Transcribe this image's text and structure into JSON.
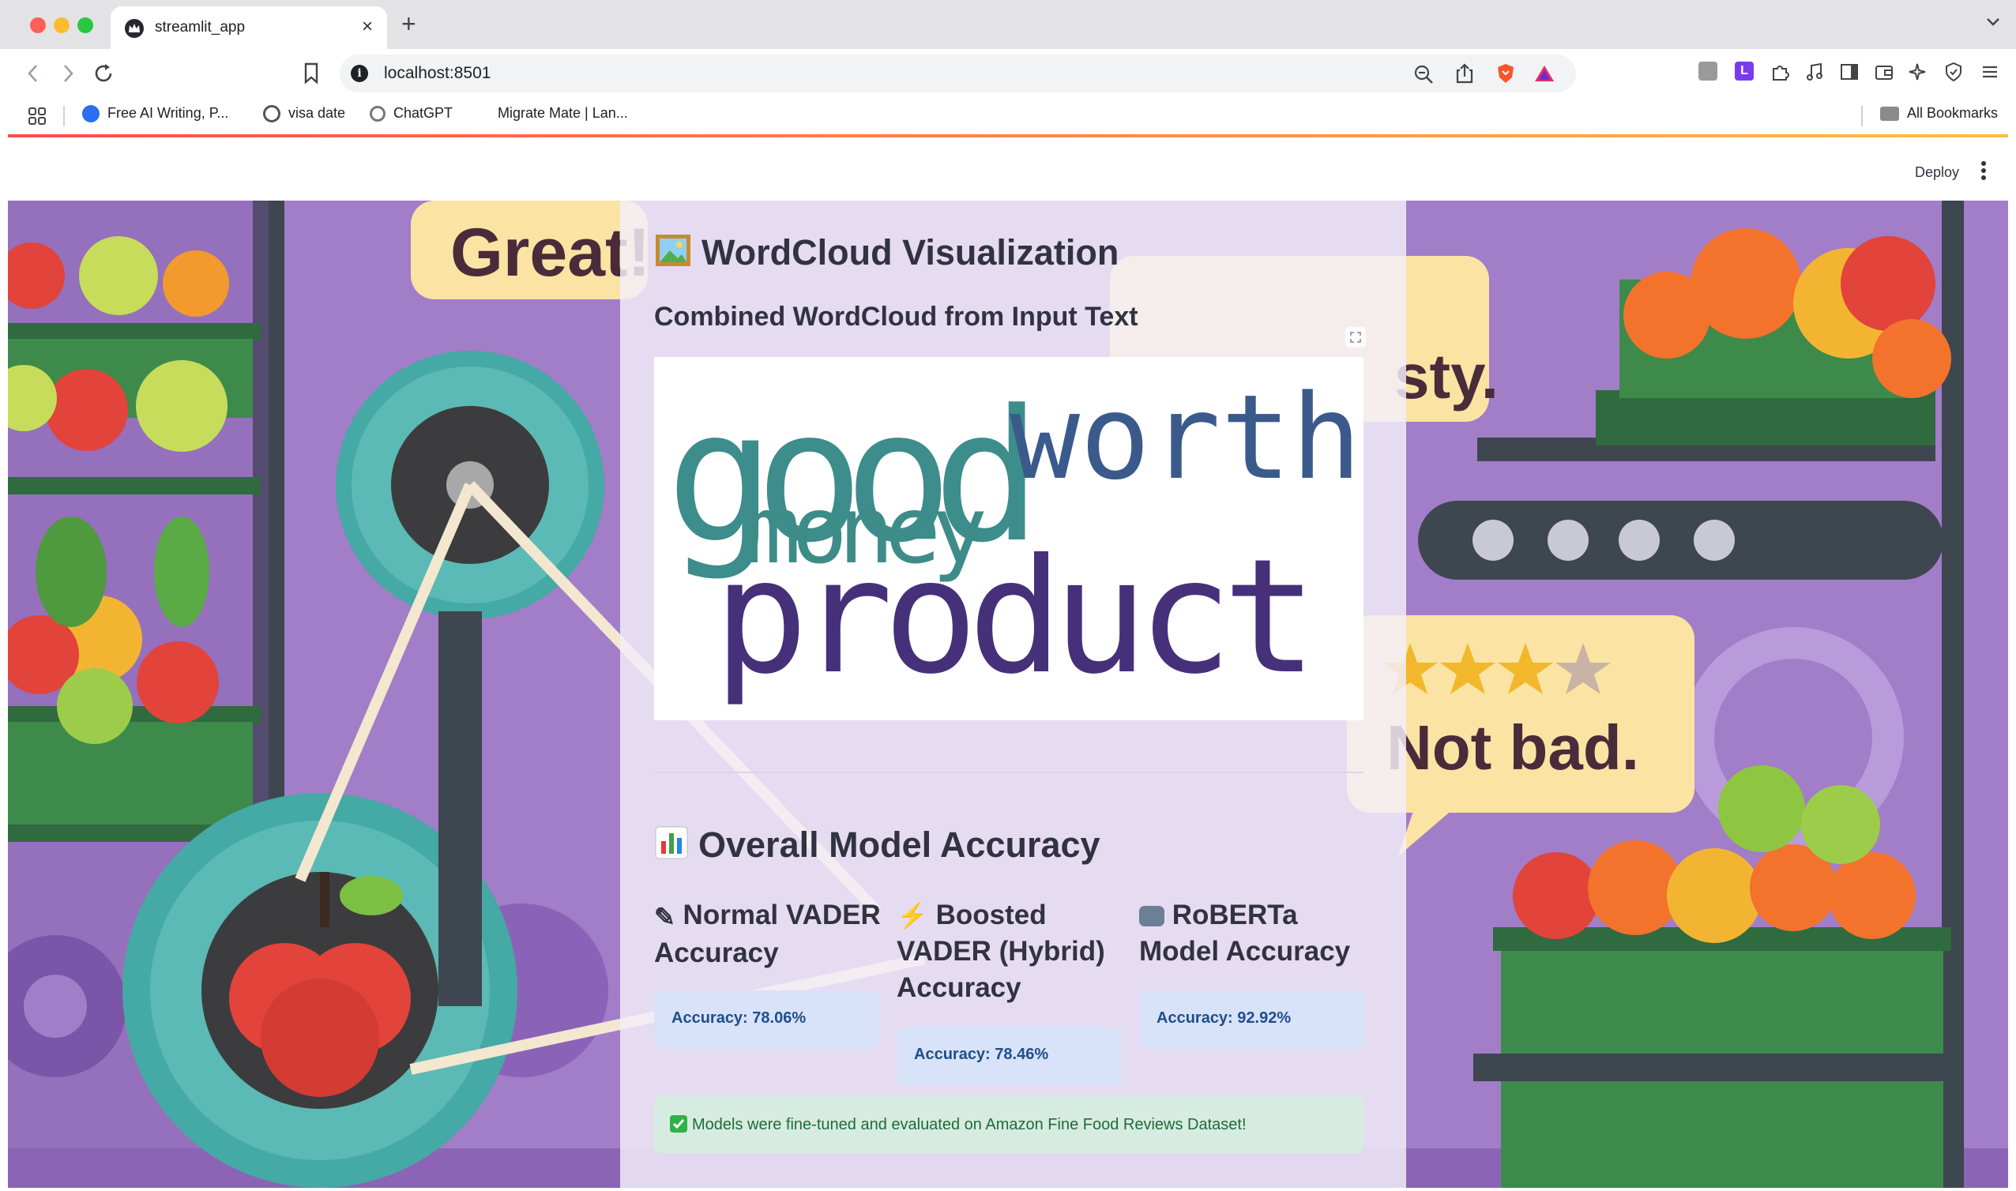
{
  "browser": {
    "tab_title": "streamlit_app",
    "url": "localhost:8501",
    "bookmarks": [
      {
        "label": "Free AI Writing, P..."
      },
      {
        "label": "visa date"
      },
      {
        "label": "ChatGPT"
      },
      {
        "label": "Migrate Mate | Lan..."
      }
    ],
    "all_bookmarks": "All Bookmarks"
  },
  "header": {
    "deploy_label": "Deploy"
  },
  "background": {
    "bubbles": [
      "Great!",
      "sty.",
      "Not bad."
    ]
  },
  "wordcloud": {
    "heading": "WordCloud Visualization",
    "subheading": "Combined WordCloud from Input Text",
    "words": [
      {
        "text": "good",
        "color": "#3c8d8c"
      },
      {
        "text": "worth",
        "color": "#3b5a8c"
      },
      {
        "text": "money",
        "color": "#3d8c88"
      },
      {
        "text": "product",
        "color": "#46307a"
      }
    ]
  },
  "accuracy": {
    "heading": "Overall Model Accuracy",
    "metrics": [
      {
        "title": "Normal VADER Accuracy",
        "value": "Accuracy: 78.06%"
      },
      {
        "title": "Boosted VADER (Hybrid) Accuracy",
        "value": "Accuracy: 78.46%"
      },
      {
        "title": "RoBERTa Model Accuracy",
        "value": "Accuracy: 92.92%"
      }
    ],
    "success_message": "Models were fine-tuned and evaluated on Amazon Fine Food Reviews Dataset!"
  },
  "colors": {
    "background_purple": "#a27dc8",
    "gear_teal": "#45a9a5",
    "progress_gradient_start": "#ff4b4b",
    "progress_gradient_end": "#ffbd45"
  }
}
